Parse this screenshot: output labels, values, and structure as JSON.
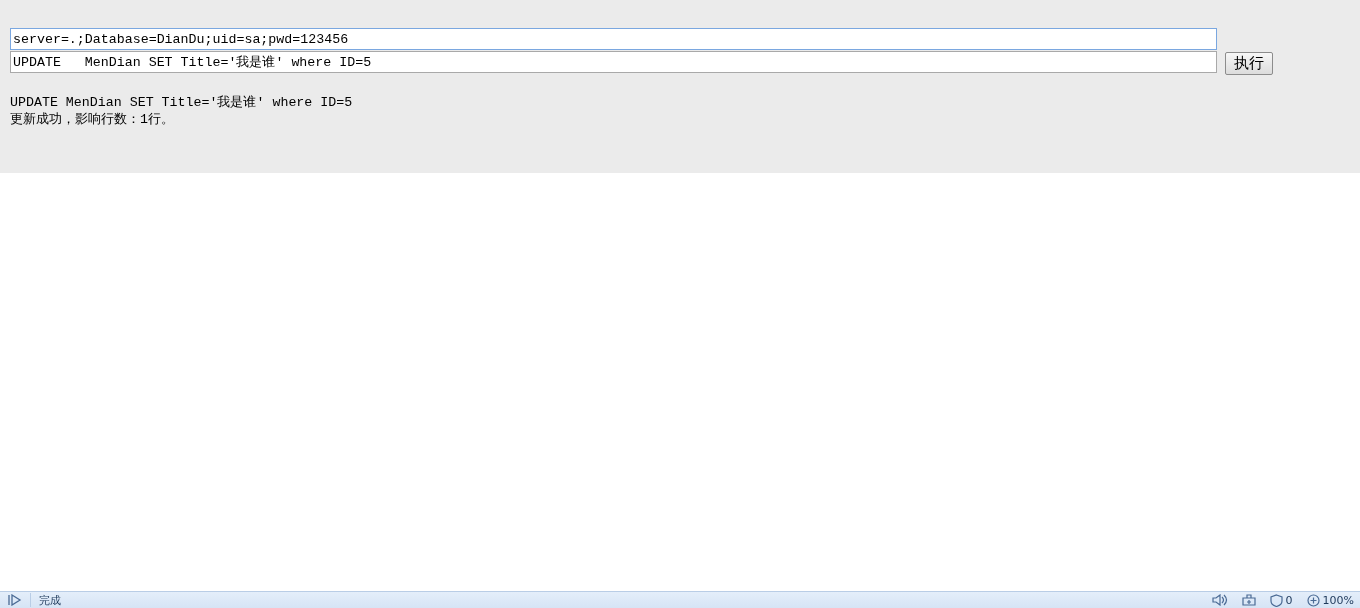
{
  "connection_field": {
    "value": "server=.;Database=DianDu;uid=sa;pwd=123456"
  },
  "sql_field": {
    "value": "UPDATE   MenDian SET Title='我是谁' where ID=5"
  },
  "execute_button": {
    "label": "执行"
  },
  "output": [
    "UPDATE MenDian SET Title='我是谁' where ID=5",
    "更新成功，影响行数：1行。"
  ],
  "status_bar": {
    "status": "完成",
    "blocked_count": "0",
    "zoom": "100%"
  }
}
